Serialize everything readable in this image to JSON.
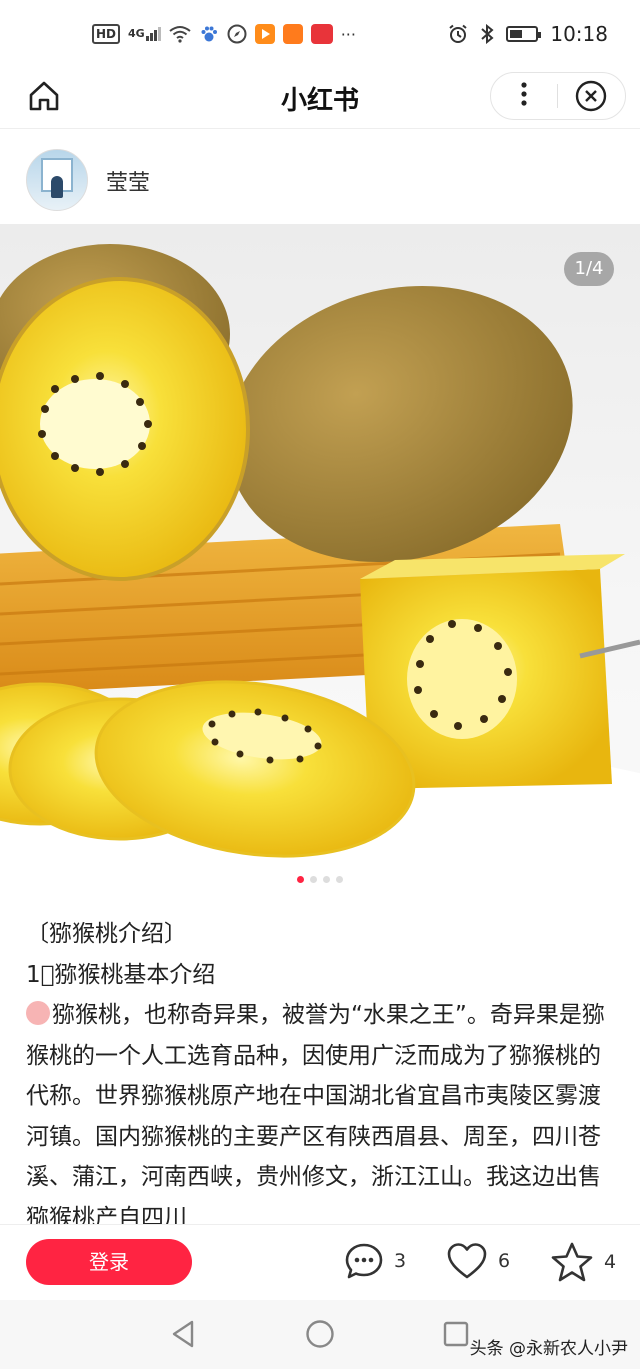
{
  "statusbar": {
    "hd": "HD",
    "network": "4G",
    "more": "···",
    "time": "10:18"
  },
  "titlebar": {
    "title": "小红书"
  },
  "author": {
    "name": "莹莹"
  },
  "photo": {
    "counter": "1/4",
    "total": 4,
    "current": 1
  },
  "content": {
    "lines": [
      "〔猕猴桃介绍〕",
      "1⃣猕猴桃基本介绍",
      "猕猴桃，也称奇异果，被誉为“水果之王”。奇异果是猕猴桃的一个人工选育品种，因使用广泛而成为了猕猴桃的代称。世界猕猴桃原产地在中国湖北省宜昌市夷陵区雾渡河镇。国内猕猴桃的主要产区有陕西眉县、周至，四川苍溪、蒲江，河南西峡，贵州修文，浙江江山。我这边出售猕猴桃产自四川"
    ]
  },
  "bottombar": {
    "login": "登录",
    "comments": "3",
    "likes": "6",
    "collects": "4"
  },
  "navbar": {
    "watermark": "头条 @永新农人小尹"
  },
  "colors": {
    "accent": "#ff2442",
    "kiwi_flesh": "#f5d21c",
    "kiwi_skin": "#a88a3a"
  }
}
